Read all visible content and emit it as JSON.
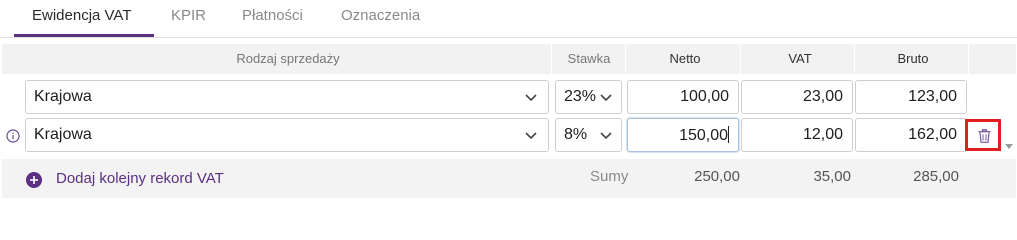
{
  "tabs": [
    {
      "label": "Ewidencja VAT",
      "active": true
    },
    {
      "label": "KPIR",
      "active": false
    },
    {
      "label": "Płatności",
      "active": false
    },
    {
      "label": "Oznaczenia",
      "active": false
    }
  ],
  "table": {
    "headers": {
      "rodzaj": "Rodzaj sprzedaży",
      "stawka": "Stawka",
      "netto": "Netto",
      "vat": "VAT",
      "brutto": "Bruto"
    },
    "rows": [
      {
        "rodzaj": "Krajowa",
        "stawka": "23%",
        "netto": "100,00",
        "vat": "23,00",
        "brutto": "123,00"
      },
      {
        "rodzaj": "Krajowa",
        "stawka": "8%",
        "netto": "150,00",
        "vat": "12,00",
        "brutto": "162,00"
      }
    ]
  },
  "footer": {
    "add_label": "Dodaj kolejny rekord VAT",
    "sums_label": "Sumy",
    "sum_netto": "250,00",
    "sum_vat": "35,00",
    "sum_brutto": "285,00"
  },
  "colors": {
    "accent": "#5b2f82",
    "delete_highlight": "#e41d1d",
    "header_bg": "#f2f2f2"
  },
  "icons": {
    "select_arrow": "chevron-down-icon",
    "info": "info-icon",
    "delete": "trash-icon",
    "add": "plus-circle-icon",
    "scroll": "scroll-down-arrow-icon"
  }
}
